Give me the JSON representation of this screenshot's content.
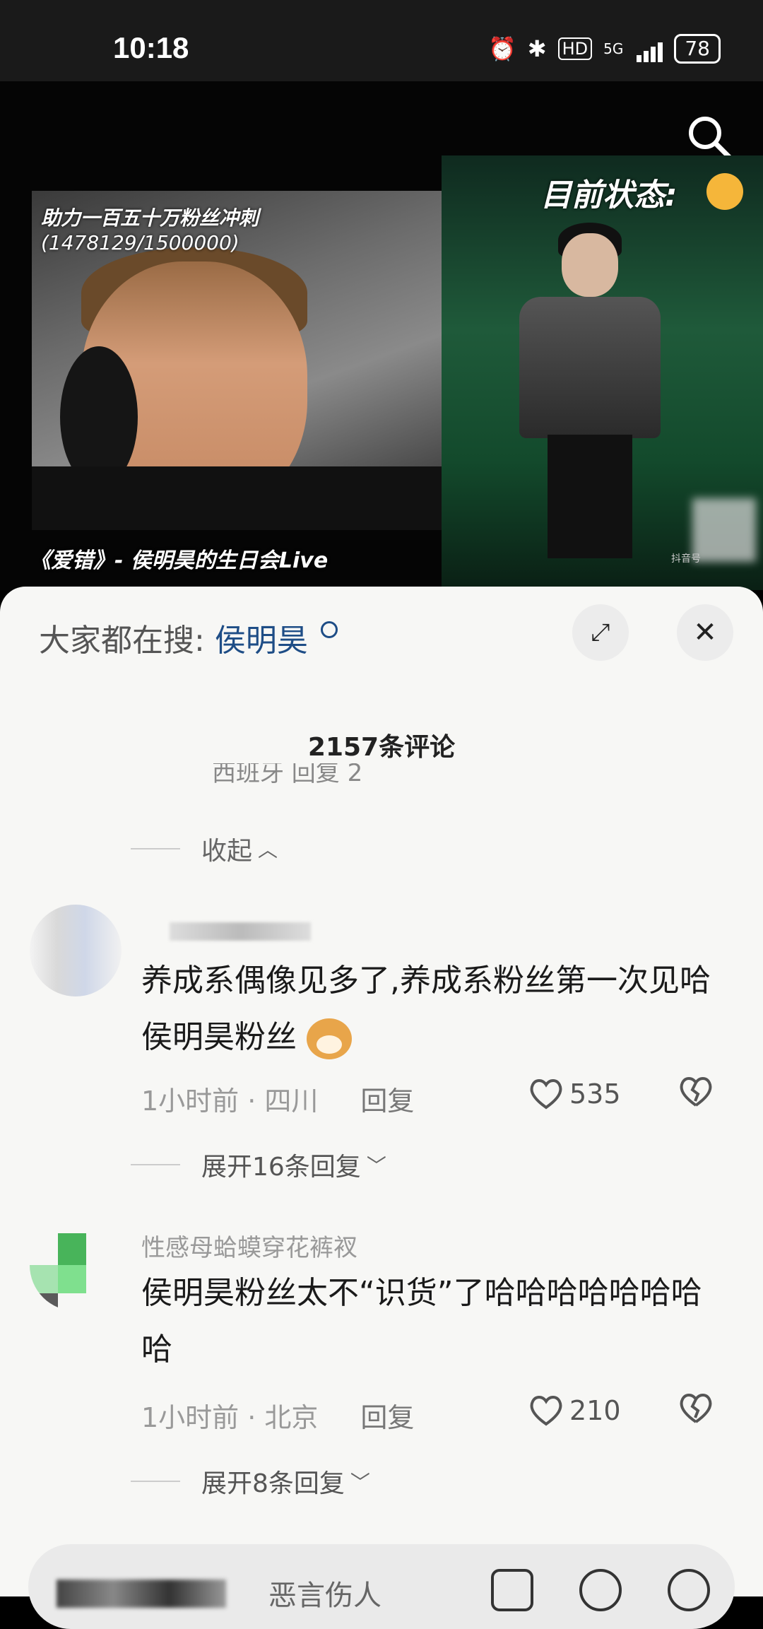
{
  "status_bar": {
    "time": "10:18",
    "network": "5G",
    "hd": "HD",
    "battery": "78",
    "icons": [
      "alarm-icon",
      "bluetooth-icon",
      "hd-icon",
      "signal-icon",
      "battery-icon"
    ]
  },
  "video": {
    "overlay_title": "助力一百五十万粉丝冲刺",
    "overlay_count": "(1478129/1500000)",
    "overlay_status": "目前状态:",
    "song_caption": "《爱错》- 侯明昊的生日会Live",
    "watermark": "抖音号",
    "search_icon": "search-icon"
  },
  "sheet": {
    "trend_prefix": "大家都在搜:",
    "trend_keyword": "侯明昊",
    "comments_count": "2157条评论",
    "cut_row_text": "西班牙     回复                                   2",
    "collapse_label": "收起",
    "comments": [
      {
        "username": "",
        "text": "养成系偶像见多了,养成系粉丝第一次见哈侯明昊粉丝",
        "time_location": "1小时前 · 四川",
        "reply_label": "回复",
        "likes": "535",
        "expand_label": "展开16条回复"
      },
      {
        "username": "性感母蛤蟆穿花裤衩",
        "text": "侯明昊粉丝太不“识货”了哈哈哈哈哈哈哈哈",
        "time_location": "1小时前 · 北京",
        "reply_label": "回复",
        "likes": "210",
        "expand_label": "展开8条回复"
      }
    ]
  },
  "input_bar": {
    "placeholder": "恶言伤人",
    "icons": [
      "image-icon",
      "at-icon",
      "emoji-icon"
    ]
  }
}
